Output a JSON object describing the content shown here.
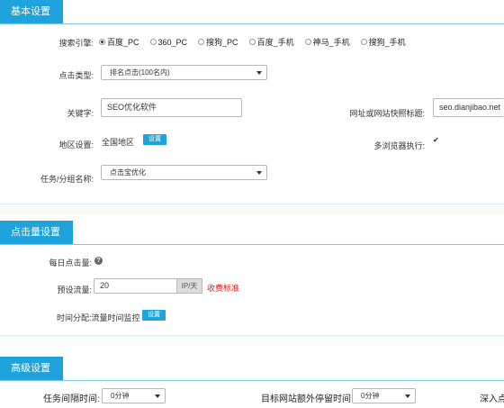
{
  "basic": {
    "title": "基本设置",
    "engine_label": "搜索引擎:",
    "engines": [
      {
        "label": "百度_PC",
        "checked": true
      },
      {
        "label": "360_PC",
        "checked": false
      },
      {
        "label": "搜狗_PC",
        "checked": false
      },
      {
        "label": "百度_手机",
        "checked": false
      },
      {
        "label": "神马_手机",
        "checked": false
      },
      {
        "label": "搜狗_手机",
        "checked": false
      }
    ],
    "click_type_label": "点击类型:",
    "click_type_value": "排名点击(100名内)",
    "keyword_label": "关键字:",
    "keyword_value": "SEO优化软件",
    "url_label": "网址或网站快照标题:",
    "url_value": "seo.dianjibao.net",
    "region_label": "地区设置:",
    "region_value": "全国地区",
    "region_button": "设置",
    "multi_browser_label": "多浏览器执行:",
    "multi_browser_checked": true,
    "task_label": "任务/分组名称:",
    "task_value": "点击宝优化"
  },
  "clicks": {
    "title": "点击量设置",
    "daily_label": "每日点击量:",
    "help_icon": "?",
    "preset_label": "预设流量:",
    "preset_value": "20",
    "preset_unit": "IP/天",
    "fee_link": "收费标准",
    "time_label": "时间分配:流量时间监控",
    "time_button": "设置"
  },
  "advanced": {
    "title": "高级设置",
    "interval_label": "任务间隔时间:",
    "interval_value": "0分钟",
    "extra_stay_label": "目标网站额外停留时间:",
    "extra_stay_value": "0分钟",
    "deep_label": "深入点"
  },
  "colors": {
    "accent": "#1fa3dc",
    "link_red": "#e02020"
  }
}
